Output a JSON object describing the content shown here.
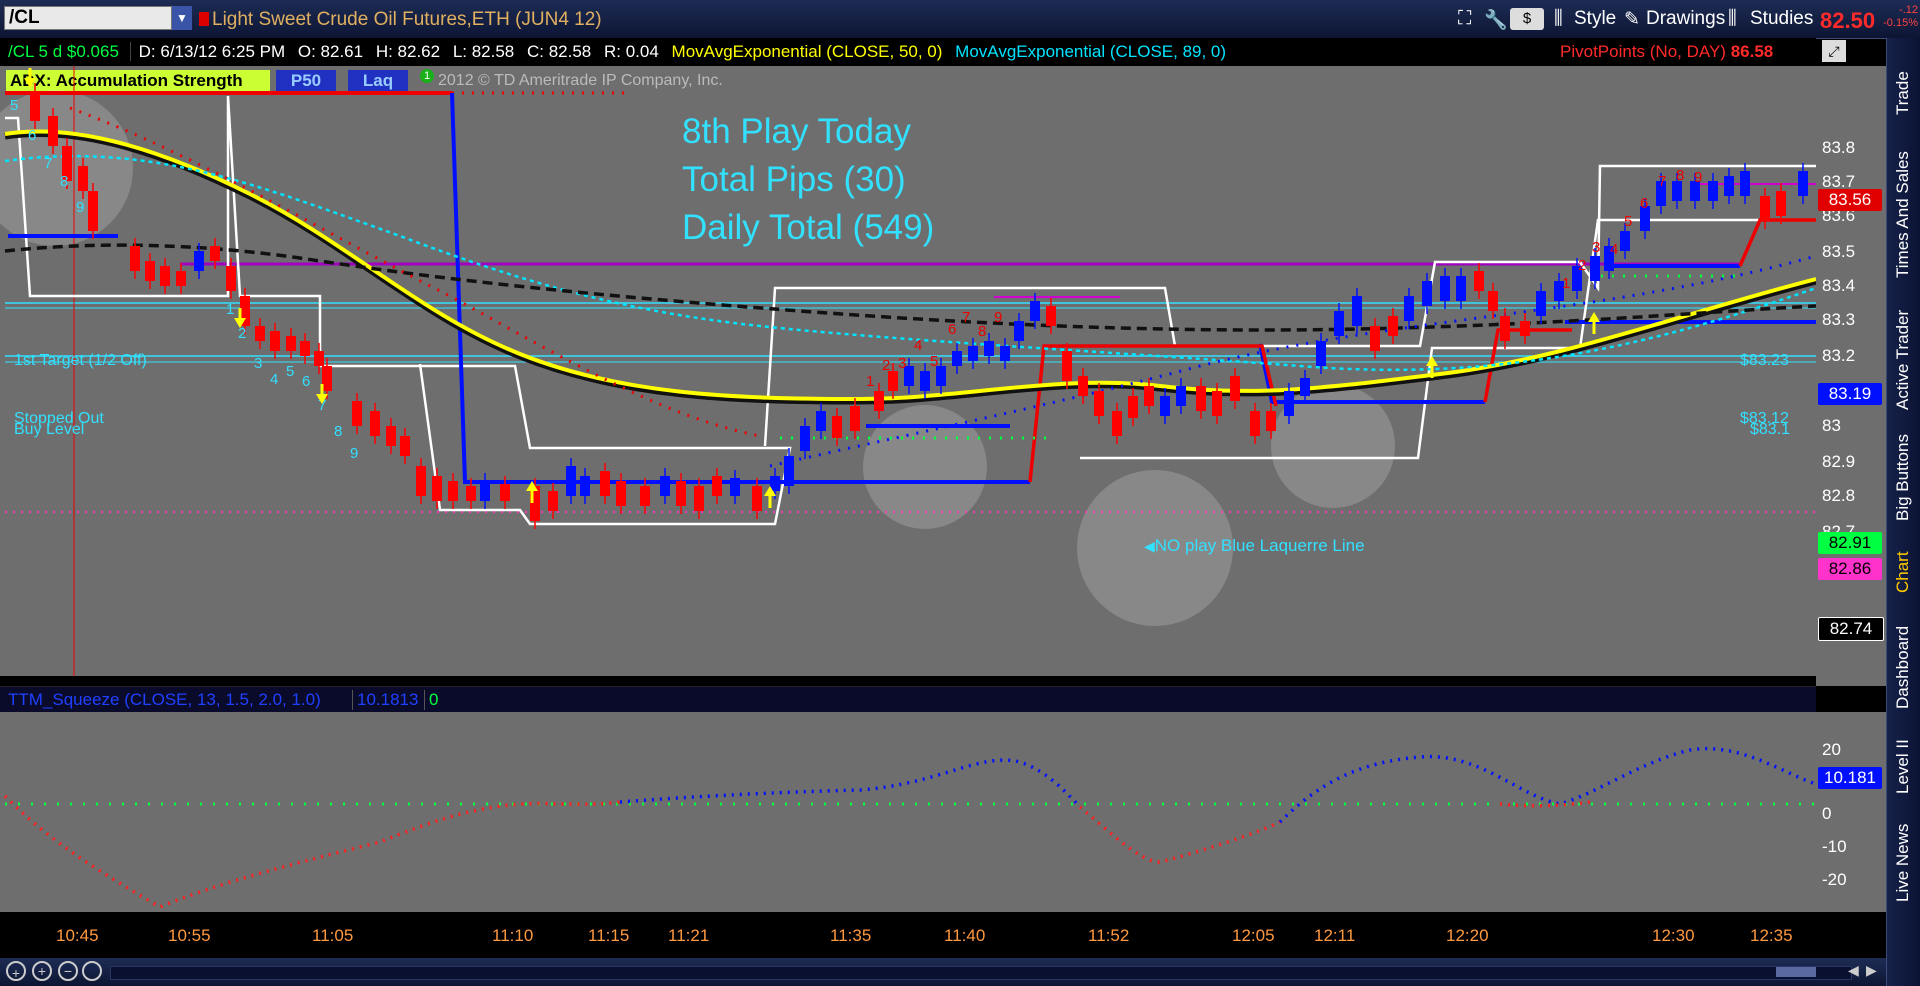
{
  "app": {
    "symbol": "/CL",
    "title": "Light Sweet Crude Oil Futures,ETH (JUN4 12)",
    "style_label": "Style",
    "drawings_label": "Drawings",
    "studies_label": "Studies",
    "last_price": "82.50",
    "change_1": "-.12",
    "change_2": "-0.15%"
  },
  "info": {
    "period": "/CL 5 d $0.065",
    "date": "D: 6/13/12 6:25 PM",
    "open": "O: 82.61",
    "high": "H: 82.62",
    "low": "L: 82.58",
    "close": "C: 82.58",
    "range": "R: 0.04",
    "ema50": "MovAvgExponential (CLOSE, 50, 0)",
    "ema89": "MovAvgExponential (CLOSE, 89, 0)",
    "pivot": "PivotPoints (No, DAY)",
    "pivot_value": "86.58"
  },
  "studies_row": {
    "adx": "ADX:  Accumulation Strength",
    "p50": "P50",
    "laq": "Laq",
    "copyright": "2012 © TD Ameritrade IP Company, Inc."
  },
  "annotations": {
    "line1": "8th Play Today",
    "line2": "Total Pips (30)",
    "line3": "Daily Total (549)",
    "first_target": "1st Target (1/2 Off)",
    "stopped_out": "Stopped Out",
    "buy_level": "Buy Level",
    "no_play": "NO play Blue Laquerre Line",
    "p8323": "$83.23",
    "p8312": "$83.12",
    "p831": "$83.1"
  },
  "price_axis": [
    "83.8",
    "83.7",
    "83.6",
    "83.5",
    "83.4",
    "83.3",
    "83.2",
    "83.1",
    "83",
    "82.9",
    "82.8",
    "82.7"
  ],
  "price_labels": {
    "l1": "83.56",
    "l2": "83.19",
    "l3": "82.91",
    "l4": "82.86",
    "l5": "82.74"
  },
  "lower": {
    "study": "TTM_Squeeze (CLOSE, 13, 1.5, 2.0, 1.0)",
    "value": "10.1813",
    "zero": "0",
    "axis": [
      "20",
      "10",
      "0",
      "-10",
      "-20"
    ],
    "label": "10.181"
  },
  "time_axis": [
    "10:45",
    "10:55",
    "11:05",
    "11:10",
    "11:15",
    "11:21",
    "11:35",
    "11:40",
    "11:52",
    "12:05",
    "12:11",
    "12:20",
    "12:30",
    "12:35"
  ],
  "nav": [
    "Trade",
    "Times And Sales",
    "Active Trader",
    "Big Buttons",
    "Chart",
    "Dashboard",
    "Level II",
    "Live News"
  ],
  "colors": {
    "bull": "#0010ff",
    "bear": "#ff0000",
    "ema50": "#ffff00",
    "ema89": "#00e5ff",
    "annot": "#32e0ff",
    "pivot": "#ff2a2a"
  }
}
